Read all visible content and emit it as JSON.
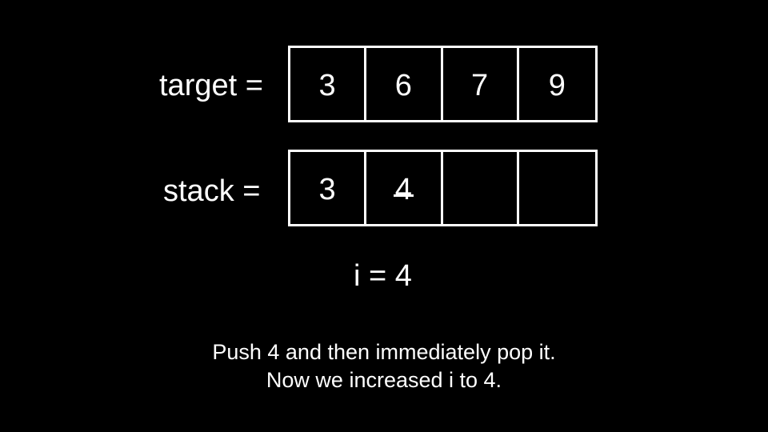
{
  "target": {
    "label": "target =",
    "cells": [
      "3",
      "6",
      "7",
      "9"
    ]
  },
  "stack": {
    "label": "stack =",
    "cells": [
      "3",
      "4",
      "",
      ""
    ],
    "struck_cell_index": 1
  },
  "counter": {
    "text": "i = 4"
  },
  "caption": {
    "line1": "Push 4 and then immediately pop it.",
    "line2": "Now we increased i to 4."
  },
  "colors": {
    "background": "#000000",
    "foreground": "#ffffff"
  }
}
